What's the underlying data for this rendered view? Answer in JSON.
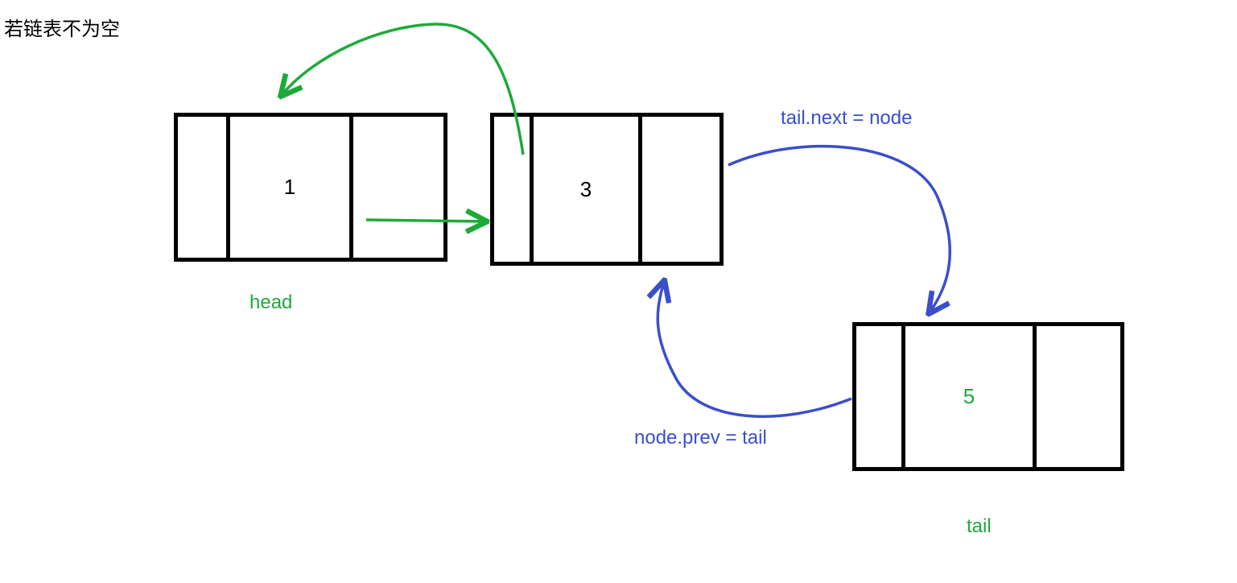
{
  "title": "若链表不为空",
  "nodes": {
    "n1": {
      "value": "1"
    },
    "n2": {
      "value": "3"
    },
    "n3": {
      "value": "5"
    }
  },
  "labels": {
    "head": "head",
    "tail": "tail",
    "tail_next": "tail.next = node",
    "node_prev": "node.prev = tail"
  },
  "colors": {
    "pointer_green": "#1eaa39",
    "pointer_blue": "#3a4fc9",
    "box_stroke": "#000000"
  }
}
